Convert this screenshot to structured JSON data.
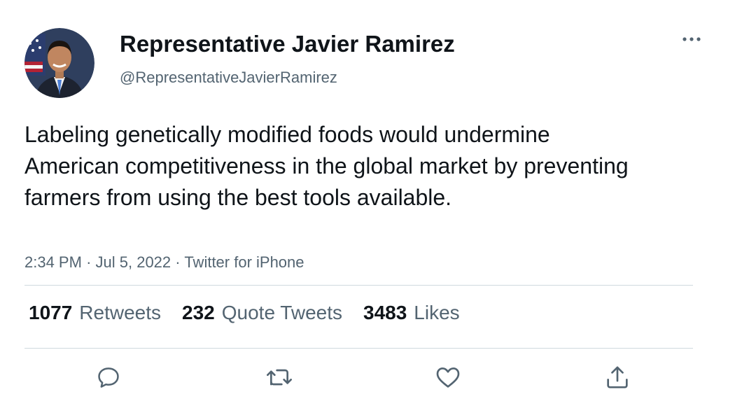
{
  "user": {
    "display_name": "Representative Javier Ramirez",
    "handle": "@RepresentativeJavierRamirez"
  },
  "tweet": {
    "text": "Labeling genetically modified foods would undermine American competitiveness in the global market by preventing farmers from using the best tools available.",
    "time": "2:34 PM",
    "date": "Jul 5, 2022",
    "source": "Twitter for iPhone"
  },
  "stats": {
    "retweets_count": "1077",
    "retweets_label": "Retweets",
    "quotes_count": "232",
    "quotes_label": "Quote Tweets",
    "likes_count": "3483",
    "likes_label": "Likes"
  },
  "icons": {
    "more": "more-icon",
    "reply": "reply-icon",
    "retweet": "retweet-icon",
    "like": "like-icon",
    "share": "share-icon"
  },
  "colors": {
    "text_primary": "#0f1419",
    "text_secondary": "#536471",
    "divider": "#cfd9de"
  }
}
